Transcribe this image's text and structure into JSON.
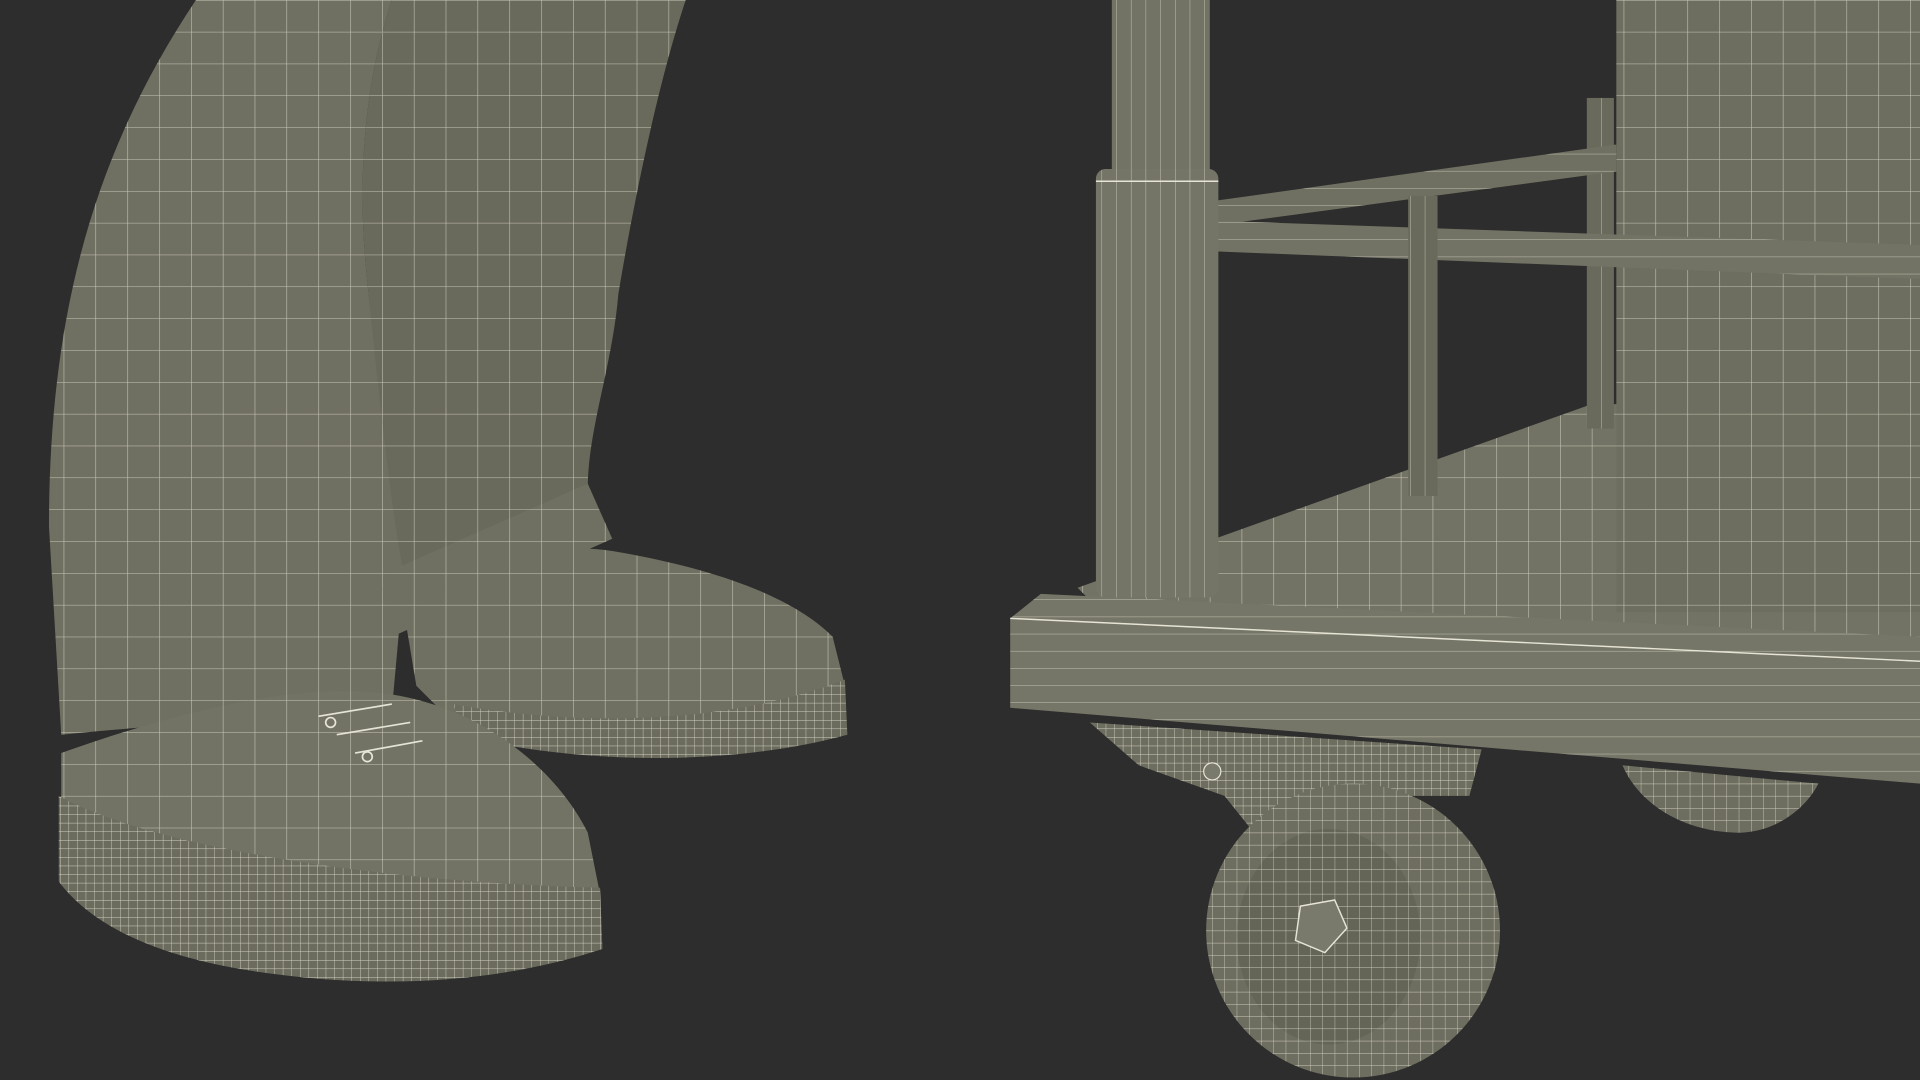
{
  "scene": {
    "background_color": "#2d2d2d",
    "surface_color": "#707062",
    "wire_color": "#e6e4d4"
  }
}
